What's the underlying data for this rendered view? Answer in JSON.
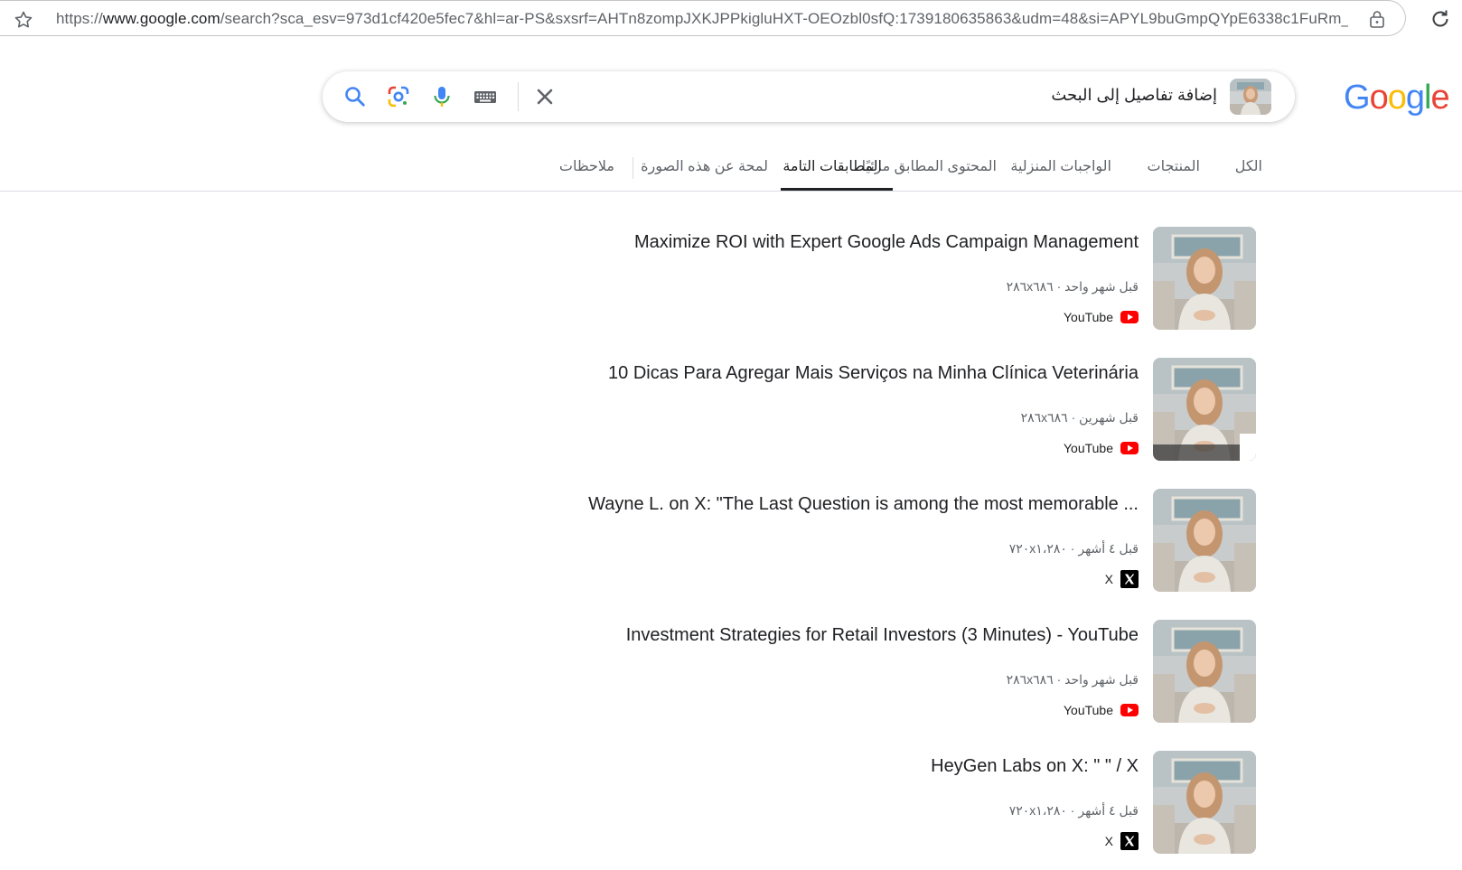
{
  "browser": {
    "url_prefix": "https://",
    "url_domain": "www.google.com",
    "url_rest": "/search?sca_esv=973d1cf420e5fec7&hl=ar-PS&sxsrf=AHTn8zompJXKJPPkigluHXT-OEOzbl0sfQ:1739180635863&udm=48&si=APYL9buGmpQYpE6338c1FuRm_..."
  },
  "logo": {
    "text": "Google"
  },
  "search": {
    "query_text": "إضافة تفاصيل إلى البحث"
  },
  "tabs": [
    {
      "label": "الكل"
    },
    {
      "label": "المنتجات"
    },
    {
      "label": "الواجبات المنزلية"
    },
    {
      "label": "المحتوى المطابق مرئيًا"
    },
    {
      "label": "المطابقات التامة",
      "active": true
    },
    {
      "label": "لمحة عن هذه الصورة"
    },
    {
      "label": "ملاحظات"
    }
  ],
  "results": [
    {
      "title": "Maximize ROI with Expert Google Ads Campaign Management",
      "meta": "قبل شهر واحد · ٢٨٦x٦٨٦",
      "source": "YouTube",
      "source_icon": "youtube-icon"
    },
    {
      "title": "10 Dicas Para Agregar Mais Serviços na Minha Clínica Veterinária",
      "meta": "قبل شهرين · ٢٨٦x٦٨٦",
      "source": "YouTube",
      "source_icon": "youtube-icon"
    },
    {
      "title": "Wayne L. on X: \"The Last Question is among the most memorable ...",
      "meta": "قبل ٤ أشهر · ٧٢٠x١،٢٨٠",
      "source": "X",
      "source_icon": "x-icon"
    },
    {
      "title": "Investment Strategies for Retail Investors (3 Minutes) - YouTube",
      "meta": "قبل شهر واحد · ٢٨٦x٦٨٦",
      "source": "YouTube",
      "source_icon": "youtube-icon"
    },
    {
      "title": "HeyGen Labs on X: \" \" / X",
      "meta": "قبل ٤ أشهر · ٧٢٠x١،٢٨٠",
      "source": "X",
      "source_icon": "x-icon"
    }
  ],
  "colors": {
    "youtube_red": "#ff0000",
    "google_blue": "#4285f4",
    "google_red": "#ea4335",
    "google_yellow": "#fbbc05",
    "google_green": "#34a853"
  }
}
